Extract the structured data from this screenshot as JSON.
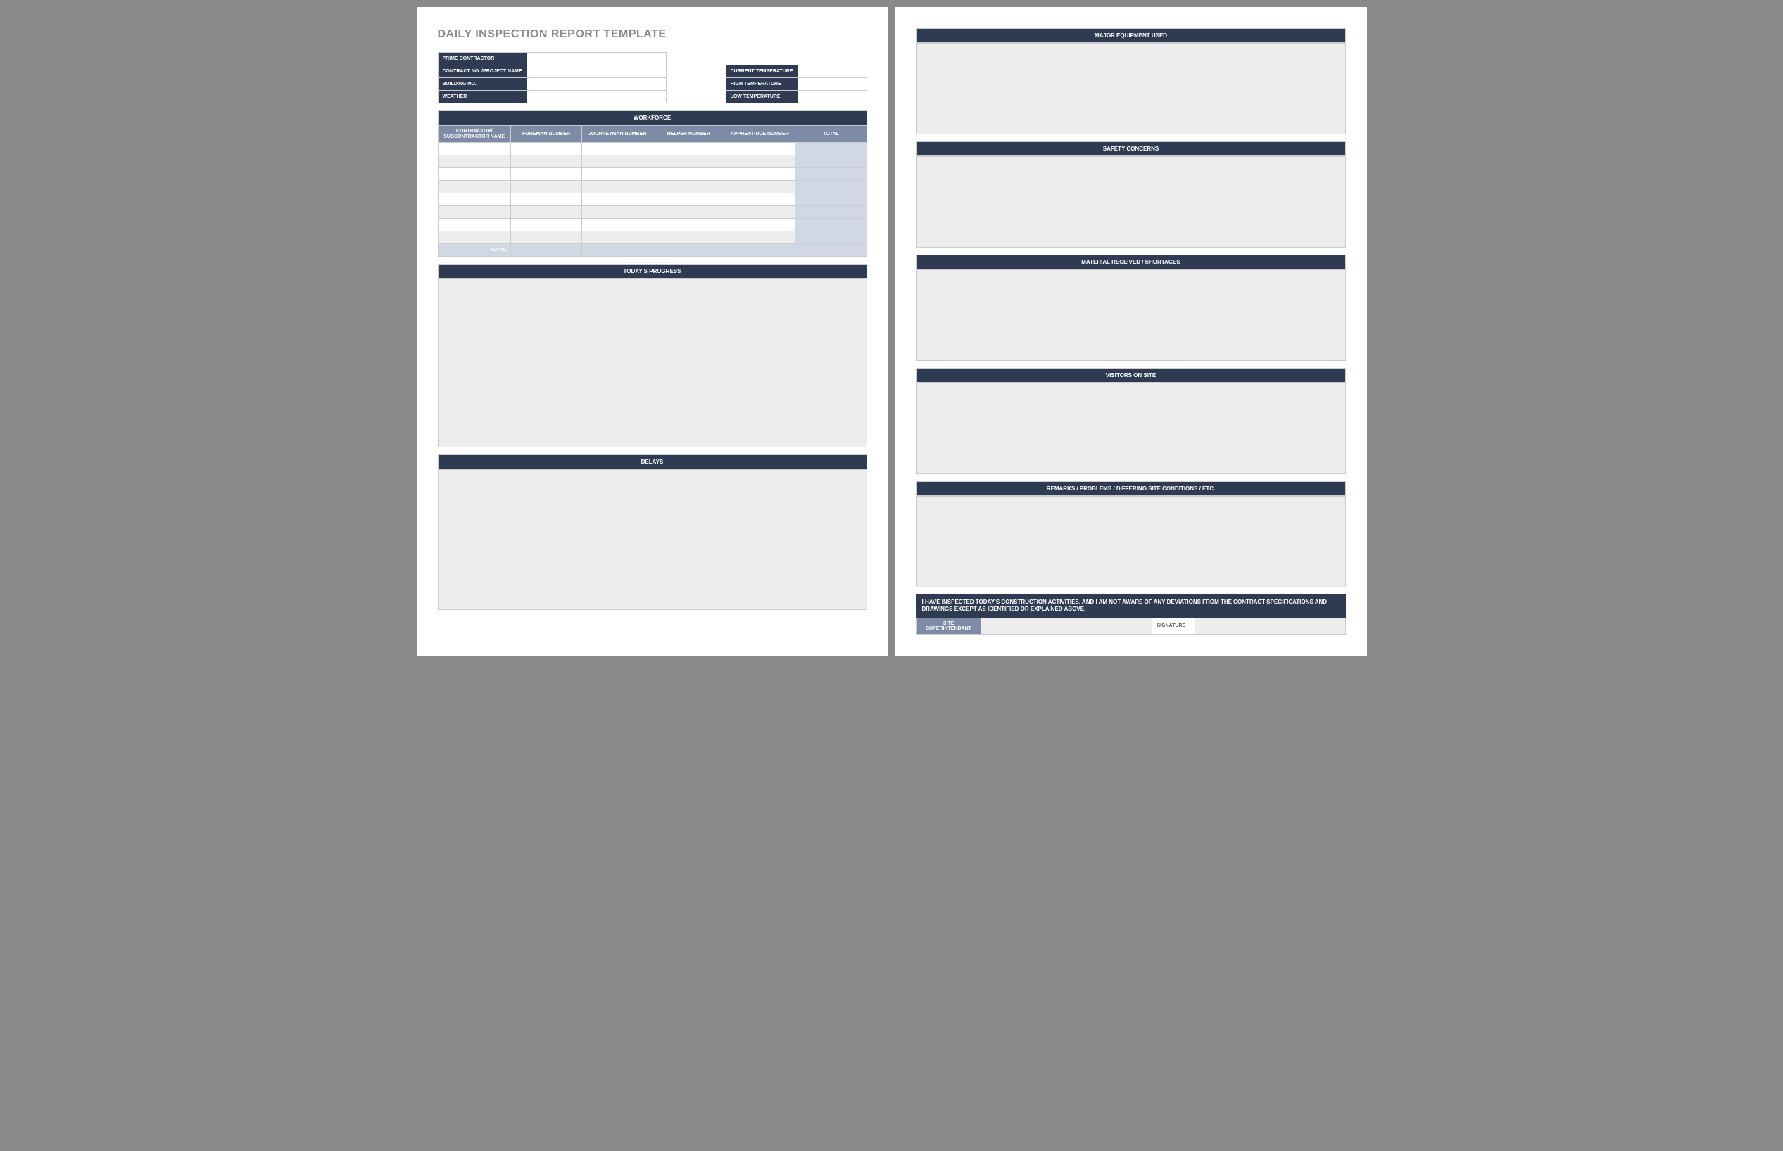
{
  "title": "DAILY INSPECTION REPORT TEMPLATE",
  "info_left": {
    "prime_contractor": {
      "label": "PRIME CONTRACTOR",
      "value": ""
    },
    "contract_no": {
      "label": "CONTRACT NO../PROJECT NAME",
      "value": ""
    },
    "building_no": {
      "label": "BUILDING NO.",
      "value": ""
    },
    "weather": {
      "label": "WEATHER",
      "value": ""
    }
  },
  "info_right": {
    "current_temp": {
      "label": "CURRENT TEMPERATURE",
      "value": ""
    },
    "high_temp": {
      "label": "HIGH TEMPERATURE",
      "value": ""
    },
    "low_temp": {
      "label": "LOW TEMPERATURE",
      "value": ""
    }
  },
  "workforce": {
    "header": "WORKFORCE",
    "columns": {
      "name": "CONTRACTOR/ SUBCONTRACTOR NAME",
      "foreman": "FOREMAN NUMBER",
      "journeyman": "JOURNEYMAN NUMBER",
      "helper": "HELPER NUMBER",
      "apprentice": "APPRENTIUCE NUMBER",
      "total": "TOTAL"
    },
    "total_label": "TOTAL",
    "rows": 8
  },
  "sections": {
    "progress": "TODAY'S PROGRESS",
    "delays": "DELAYS",
    "equipment": "MAJOR EQUIPMENT USED",
    "safety": "SAFETY CONCERNS",
    "material": "MATERIAL RECEIVED / SHORTAGES",
    "visitors": "VISITORS ON SITE",
    "remarks": "REMARKS / PROBLEMS / DIFFERING SITE CONDITIONS / ETC."
  },
  "certification": "I HAVE INSPECTED TODAY'S CONSTRUCTION ACTIVITIES, AND I AM NOT AWARE OF ANY DEVIATIONS FROM THE CONTRACT SPECIFICATIONS AND DRAWINGS EXCEPT AS IDENTIFIED OR EXPLAINED ABOVE.",
  "signature": {
    "site_super": "SITE SUPERINTENDANT",
    "sig_label": "SIGNATURE"
  }
}
